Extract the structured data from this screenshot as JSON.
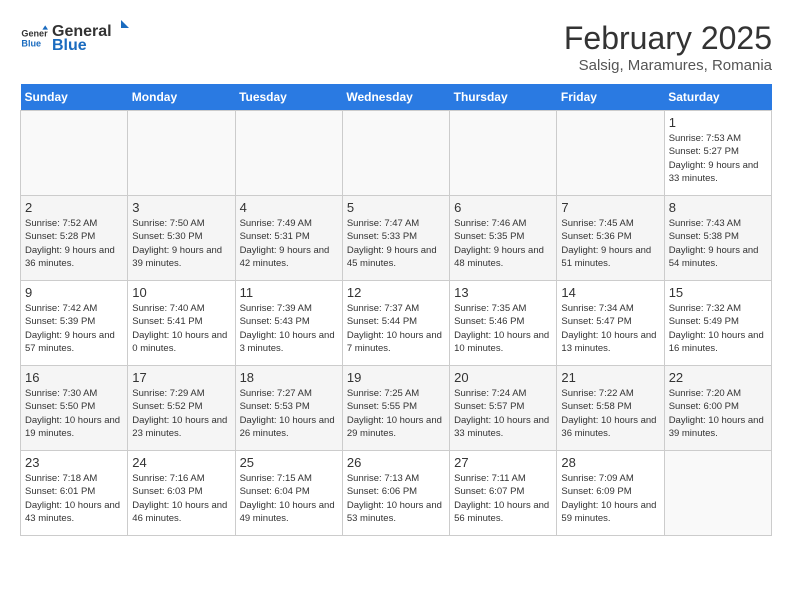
{
  "header": {
    "logo_general": "General",
    "logo_blue": "Blue",
    "month_year": "February 2025",
    "location": "Salsig, Maramures, Romania"
  },
  "days_of_week": [
    "Sunday",
    "Monday",
    "Tuesday",
    "Wednesday",
    "Thursday",
    "Friday",
    "Saturday"
  ],
  "weeks": [
    [
      {
        "day": "",
        "info": ""
      },
      {
        "day": "",
        "info": ""
      },
      {
        "day": "",
        "info": ""
      },
      {
        "day": "",
        "info": ""
      },
      {
        "day": "",
        "info": ""
      },
      {
        "day": "",
        "info": ""
      },
      {
        "day": "1",
        "info": "Sunrise: 7:53 AM\nSunset: 5:27 PM\nDaylight: 9 hours and 33 minutes."
      }
    ],
    [
      {
        "day": "2",
        "info": "Sunrise: 7:52 AM\nSunset: 5:28 PM\nDaylight: 9 hours and 36 minutes."
      },
      {
        "day": "3",
        "info": "Sunrise: 7:50 AM\nSunset: 5:30 PM\nDaylight: 9 hours and 39 minutes."
      },
      {
        "day": "4",
        "info": "Sunrise: 7:49 AM\nSunset: 5:31 PM\nDaylight: 9 hours and 42 minutes."
      },
      {
        "day": "5",
        "info": "Sunrise: 7:47 AM\nSunset: 5:33 PM\nDaylight: 9 hours and 45 minutes."
      },
      {
        "day": "6",
        "info": "Sunrise: 7:46 AM\nSunset: 5:35 PM\nDaylight: 9 hours and 48 minutes."
      },
      {
        "day": "7",
        "info": "Sunrise: 7:45 AM\nSunset: 5:36 PM\nDaylight: 9 hours and 51 minutes."
      },
      {
        "day": "8",
        "info": "Sunrise: 7:43 AM\nSunset: 5:38 PM\nDaylight: 9 hours and 54 minutes."
      }
    ],
    [
      {
        "day": "9",
        "info": "Sunrise: 7:42 AM\nSunset: 5:39 PM\nDaylight: 9 hours and 57 minutes."
      },
      {
        "day": "10",
        "info": "Sunrise: 7:40 AM\nSunset: 5:41 PM\nDaylight: 10 hours and 0 minutes."
      },
      {
        "day": "11",
        "info": "Sunrise: 7:39 AM\nSunset: 5:43 PM\nDaylight: 10 hours and 3 minutes."
      },
      {
        "day": "12",
        "info": "Sunrise: 7:37 AM\nSunset: 5:44 PM\nDaylight: 10 hours and 7 minutes."
      },
      {
        "day": "13",
        "info": "Sunrise: 7:35 AM\nSunset: 5:46 PM\nDaylight: 10 hours and 10 minutes."
      },
      {
        "day": "14",
        "info": "Sunrise: 7:34 AM\nSunset: 5:47 PM\nDaylight: 10 hours and 13 minutes."
      },
      {
        "day": "15",
        "info": "Sunrise: 7:32 AM\nSunset: 5:49 PM\nDaylight: 10 hours and 16 minutes."
      }
    ],
    [
      {
        "day": "16",
        "info": "Sunrise: 7:30 AM\nSunset: 5:50 PM\nDaylight: 10 hours and 19 minutes."
      },
      {
        "day": "17",
        "info": "Sunrise: 7:29 AM\nSunset: 5:52 PM\nDaylight: 10 hours and 23 minutes."
      },
      {
        "day": "18",
        "info": "Sunrise: 7:27 AM\nSunset: 5:53 PM\nDaylight: 10 hours and 26 minutes."
      },
      {
        "day": "19",
        "info": "Sunrise: 7:25 AM\nSunset: 5:55 PM\nDaylight: 10 hours and 29 minutes."
      },
      {
        "day": "20",
        "info": "Sunrise: 7:24 AM\nSunset: 5:57 PM\nDaylight: 10 hours and 33 minutes."
      },
      {
        "day": "21",
        "info": "Sunrise: 7:22 AM\nSunset: 5:58 PM\nDaylight: 10 hours and 36 minutes."
      },
      {
        "day": "22",
        "info": "Sunrise: 7:20 AM\nSunset: 6:00 PM\nDaylight: 10 hours and 39 minutes."
      }
    ],
    [
      {
        "day": "23",
        "info": "Sunrise: 7:18 AM\nSunset: 6:01 PM\nDaylight: 10 hours and 43 minutes."
      },
      {
        "day": "24",
        "info": "Sunrise: 7:16 AM\nSunset: 6:03 PM\nDaylight: 10 hours and 46 minutes."
      },
      {
        "day": "25",
        "info": "Sunrise: 7:15 AM\nSunset: 6:04 PM\nDaylight: 10 hours and 49 minutes."
      },
      {
        "day": "26",
        "info": "Sunrise: 7:13 AM\nSunset: 6:06 PM\nDaylight: 10 hours and 53 minutes."
      },
      {
        "day": "27",
        "info": "Sunrise: 7:11 AM\nSunset: 6:07 PM\nDaylight: 10 hours and 56 minutes."
      },
      {
        "day": "28",
        "info": "Sunrise: 7:09 AM\nSunset: 6:09 PM\nDaylight: 10 hours and 59 minutes."
      },
      {
        "day": "",
        "info": ""
      }
    ]
  ]
}
